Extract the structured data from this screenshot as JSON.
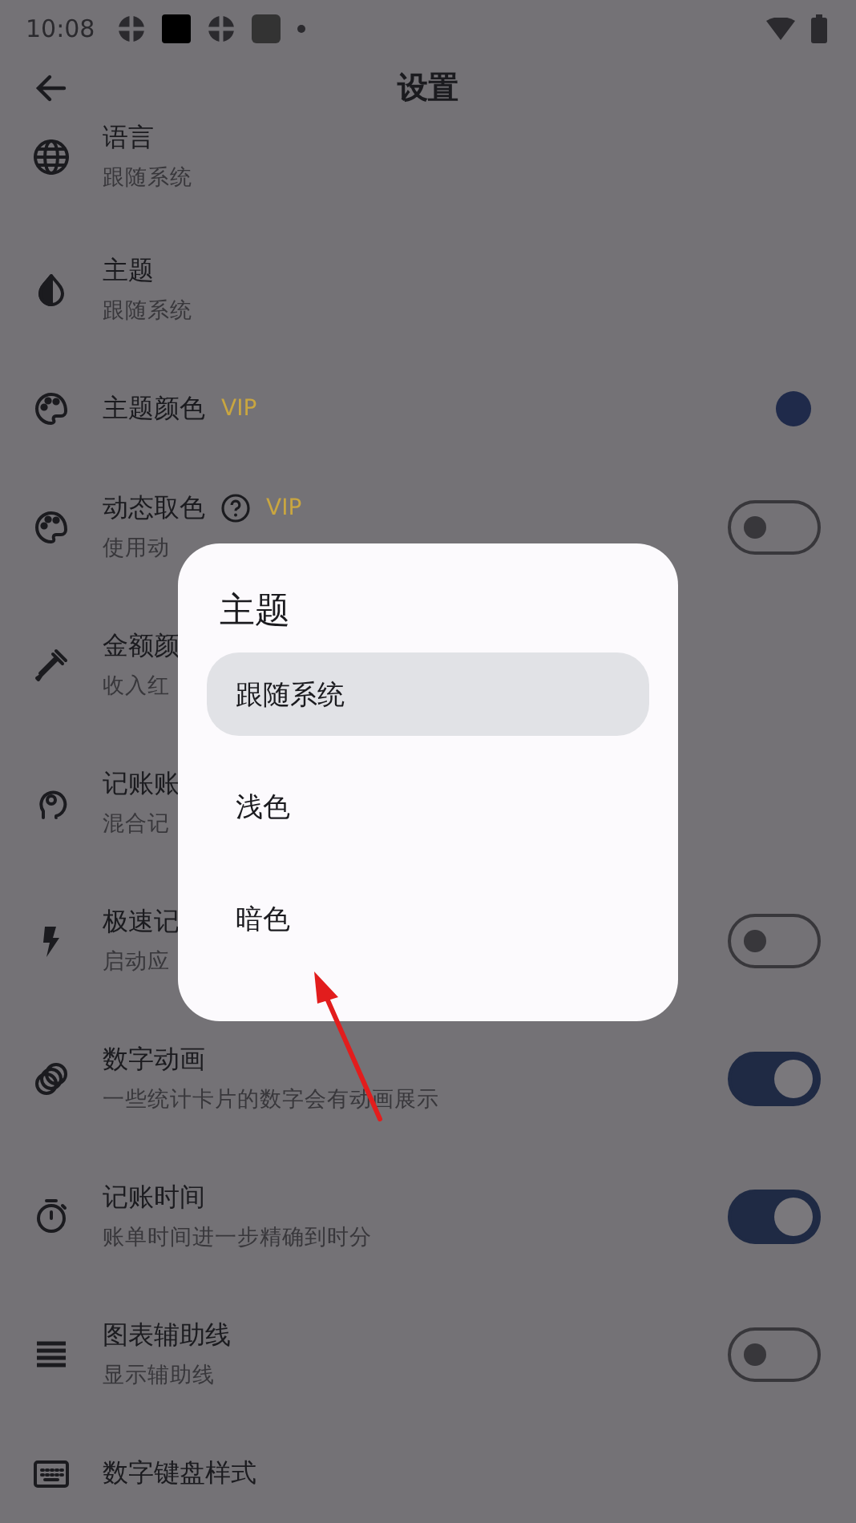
{
  "status_bar": {
    "time": "10:08"
  },
  "app_bar": {
    "title": "设置"
  },
  "settings": [
    {
      "kind": "plain",
      "title": "语言",
      "subtitle": "跟随系统"
    },
    {
      "kind": "plain",
      "title": "主题",
      "subtitle": "跟随系统"
    },
    {
      "kind": "color",
      "title": "主题颜色",
      "badge": "VIP",
      "color": "#1f2a4a"
    },
    {
      "kind": "toggle",
      "title": "动态取色",
      "help": true,
      "badge": "VIP",
      "subtitle": "使用动",
      "on": false
    },
    {
      "kind": "plain",
      "title": "金额颜",
      "subtitle": "收入红"
    },
    {
      "kind": "plain",
      "title": "记账账",
      "subtitle": "混合记"
    },
    {
      "kind": "toggle",
      "title": "极速记",
      "subtitle": "启动应",
      "on": false
    },
    {
      "kind": "toggle",
      "title": "数字动画",
      "subtitle": "一些统计卡片的数字会有动画展示",
      "on": true
    },
    {
      "kind": "toggle",
      "title": "记账时间",
      "subtitle": "账单时间进一步精确到时分",
      "on": true
    },
    {
      "kind": "toggle",
      "title": "图表辅助线",
      "subtitle": "显示辅助线",
      "on": false
    },
    {
      "kind": "plain",
      "title": "数字键盘样式"
    }
  ],
  "dialog": {
    "title": "主题",
    "options": [
      {
        "label": "跟随系统",
        "selected": true
      },
      {
        "label": "浅色",
        "selected": false
      },
      {
        "label": "暗色",
        "selected": false
      }
    ]
  }
}
